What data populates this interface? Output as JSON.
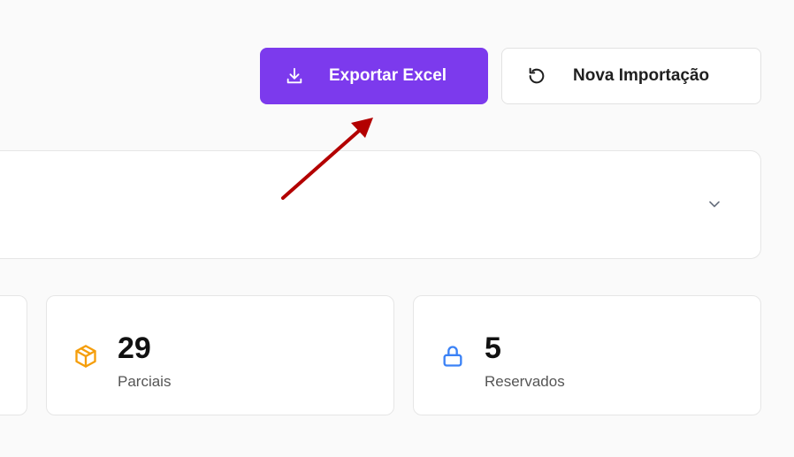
{
  "toolbar": {
    "export_label": "Exportar Excel",
    "import_label": "Nova Importação"
  },
  "icons": {
    "export": "download-icon",
    "import": "refresh-icon",
    "dropdown": "chevron-down-icon",
    "parciais": "package-icon",
    "reservados": "lock-icon"
  },
  "stats": [
    {
      "value": "29",
      "label": "Parciais"
    },
    {
      "value": "5",
      "label": "Reservados"
    }
  ],
  "colors": {
    "accent": "#7c3aed",
    "package_icon": "#f59e0b",
    "lock_icon": "#3b82f6",
    "annotation_arrow": "#b30000"
  }
}
